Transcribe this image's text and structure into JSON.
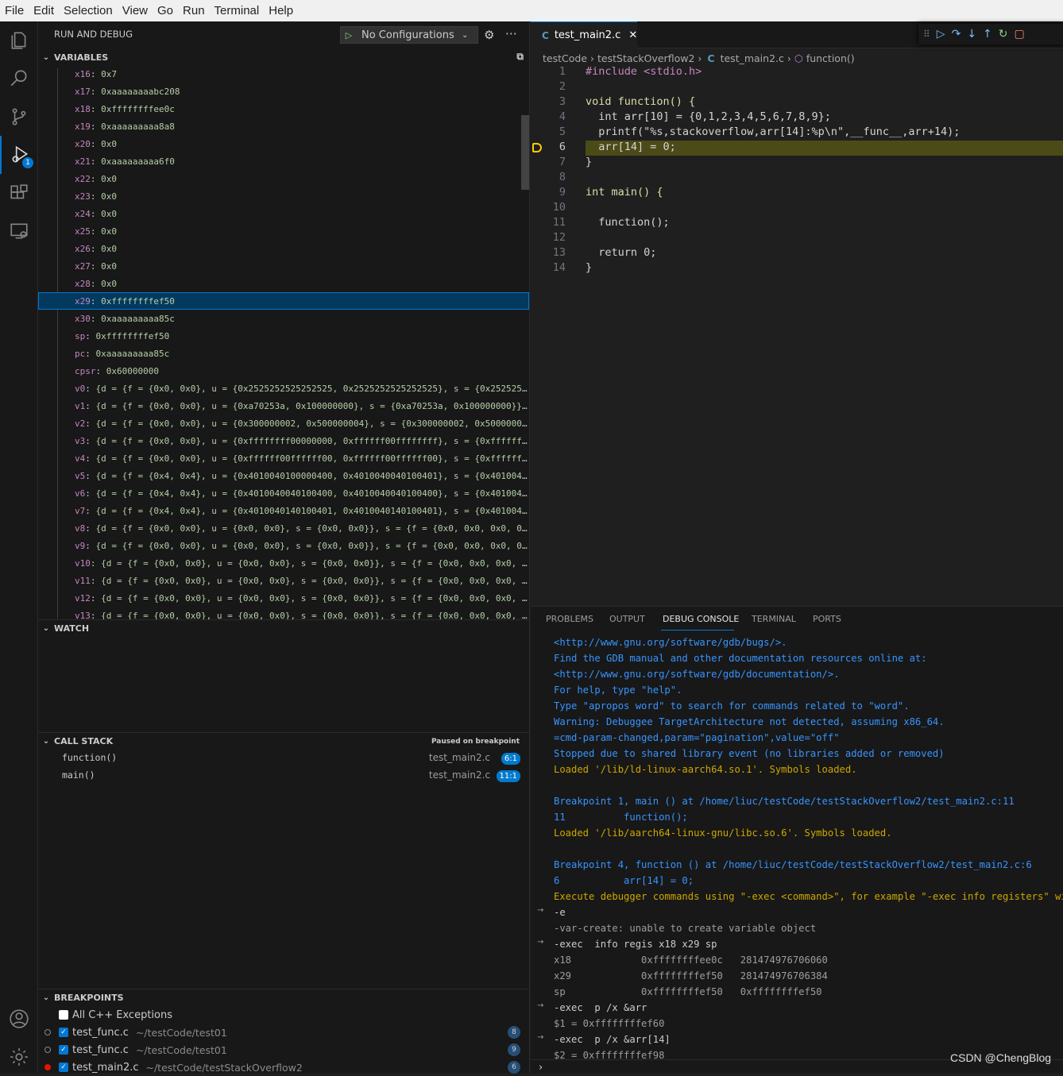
{
  "menu": [
    "File",
    "Edit",
    "Selection",
    "View",
    "Go",
    "Run",
    "Terminal",
    "Help"
  ],
  "sidebar": {
    "title": "RUN AND DEBUG",
    "config": "No Configurations",
    "variables_header": "VARIABLES",
    "variables": [
      {
        "name": "x16",
        "value": "0x7"
      },
      {
        "name": "x17",
        "value": "0xaaaaaaaabc208"
      },
      {
        "name": "x18",
        "value": "0xffffffffee0c"
      },
      {
        "name": "x19",
        "value": "0xaaaaaaaaa8a8"
      },
      {
        "name": "x20",
        "value": "0x0"
      },
      {
        "name": "x21",
        "value": "0xaaaaaaaaa6f0"
      },
      {
        "name": "x22",
        "value": "0x0"
      },
      {
        "name": "x23",
        "value": "0x0"
      },
      {
        "name": "x24",
        "value": "0x0"
      },
      {
        "name": "x25",
        "value": "0x0"
      },
      {
        "name": "x26",
        "value": "0x0"
      },
      {
        "name": "x27",
        "value": "0x0"
      },
      {
        "name": "x28",
        "value": "0x0"
      },
      {
        "name": "x29",
        "value": "0xffffffffef50"
      },
      {
        "name": "x30",
        "value": "0xaaaaaaaaa85c"
      },
      {
        "name": "sp",
        "value": "0xffffffffef50"
      },
      {
        "name": "pc",
        "value": "0xaaaaaaaaa85c"
      },
      {
        "name": "cpsr",
        "value": "0x60000000"
      },
      {
        "name": "v0",
        "value": "{d = {f = {0x0, 0x0}, u = {0x2525252525252525, 0x2525252525252525}, s = {0x25252525…"
      },
      {
        "name": "v1",
        "value": "{d = {f = {0x0, 0x0}, u = {0xa70253a, 0x100000000}, s = {0xa70253a, 0x100000000}}, …"
      },
      {
        "name": "v2",
        "value": "{d = {f = {0x0, 0x0}, u = {0x300000002, 0x500000004}, s = {0x300000002, 0x500000004…"
      },
      {
        "name": "v3",
        "value": "{d = {f = {0x0, 0x0}, u = {0xffffffff00000000, 0xffffff00ffffffff}, s = {0xffffffff…"
      },
      {
        "name": "v4",
        "value": "{d = {f = {0x0, 0x0}, u = {0xffffff00ffffff00, 0xffffff00ffffff00}, s = {0xffffff00…"
      },
      {
        "name": "v5",
        "value": "{d = {f = {0x4, 0x4}, u = {0x4010040100000400, 0x4010040040100401}, s = {0x40100401…"
      },
      {
        "name": "v6",
        "value": "{d = {f = {0x4, 0x4}, u = {0x4010040040100400, 0x4010040040100400}, s = {0x40100400…"
      },
      {
        "name": "v7",
        "value": "{d = {f = {0x4, 0x4}, u = {0x4010040140100401, 0x4010040140100401}, s = {0x40100401…"
      },
      {
        "name": "v8",
        "value": "{d = {f = {0x0, 0x0}, u = {0x0, 0x0}, s = {0x0, 0x0}}, s = {f = {0x0, 0x0, 0x0, 0x0…"
      },
      {
        "name": "v9",
        "value": "{d = {f = {0x0, 0x0}, u = {0x0, 0x0}, s = {0x0, 0x0}}, s = {f = {0x0, 0x0, 0x0, 0x0…"
      },
      {
        "name": "v10",
        "value": "{d = {f = {0x0, 0x0}, u = {0x0, 0x0}, s = {0x0, 0x0}}, s = {f = {0x0, 0x0, 0x0, 0x…"
      },
      {
        "name": "v11",
        "value": "{d = {f = {0x0, 0x0}, u = {0x0, 0x0}, s = {0x0, 0x0}}, s = {f = {0x0, 0x0, 0x0, 0x…"
      },
      {
        "name": "v12",
        "value": "{d = {f = {0x0, 0x0}, u = {0x0, 0x0}, s = {0x0, 0x0}}, s = {f = {0x0, 0x0, 0x0, 0x…"
      },
      {
        "name": "v13",
        "value": "{d = {f = {0x0, 0x0}, u = {0x0, 0x0}, s = {0x0, 0x0}}, s = {f = {0x0, 0x0, 0x0, 0x…"
      }
    ],
    "watch_header": "WATCH",
    "callstack_header": "CALL STACK",
    "callstack_status": "Paused on breakpoint",
    "callstack": [
      {
        "fn": "function()",
        "file": "test_main2.c",
        "pos": "6:1"
      },
      {
        "fn": "main()",
        "file": "test_main2.c",
        "pos": "11:1"
      }
    ],
    "breakpoints_header": "BREAKPOINTS",
    "breakpoints": [
      {
        "file": "All C++ Exceptions",
        "path": "",
        "count": ""
      },
      {
        "file": "test_func.c",
        "path": "~/testCode/test01",
        "count": "8"
      },
      {
        "file": "test_func.c",
        "path": "~/testCode/test01",
        "count": "9"
      },
      {
        "file": "test_main2.c",
        "path": "~/testCode/testStackOverflow2",
        "count": "6"
      }
    ]
  },
  "editor": {
    "tab": "test_main2.c",
    "breadcrumb": [
      "testCode",
      "testStackOverflow2",
      "test_main2.c",
      "function()"
    ],
    "lines": [
      "#include <stdio.h>",
      "",
      "void function() {",
      "  int arr[10] = {0,1,2,3,4,5,6,7,8,9};",
      "  printf(\"%s,stackoverflow,arr[14]:%p\\n\",__func__,arr+14);",
      "  arr[14] = 0;",
      "}",
      "",
      "int main() {",
      "",
      "  function();",
      "",
      "  return 0;",
      "}"
    ],
    "line_numbers": [
      "1",
      "2",
      "3",
      "4",
      "5",
      "6",
      "7",
      "8",
      "9",
      "10",
      "11",
      "12",
      "13",
      "14"
    ]
  },
  "panel": {
    "tabs": [
      "PROBLEMS",
      "OUTPUT",
      "DEBUG CONSOLE",
      "TERMINAL",
      "PORTS"
    ],
    "console": [
      {
        "t": "<http://www.gnu.org/software/gdb/bugs/>.",
        "c": "blue",
        "a": false
      },
      {
        "t": "Find the GDB manual and other documentation resources online at:",
        "c": "blue",
        "a": false
      },
      {
        "t": "<http://www.gnu.org/software/gdb/documentation/>.",
        "c": "blue",
        "a": false
      },
      {
        "t": "For help, type \"help\".",
        "c": "blue",
        "a": false
      },
      {
        "t": "Type \"apropos word\" to search for commands related to \"word\".",
        "c": "blue",
        "a": false
      },
      {
        "t": "Warning: Debuggee TargetArchitecture not detected, assuming x86_64.",
        "c": "blue",
        "a": false
      },
      {
        "t": "=cmd-param-changed,param=\"pagination\",value=\"off\"",
        "c": "blue",
        "a": false
      },
      {
        "t": "Stopped due to shared library event (no libraries added or removed)",
        "c": "blue",
        "a": false
      },
      {
        "t": "Loaded '/lib/ld-linux-aarch64.so.1'. Symbols loaded.",
        "c": "orange",
        "a": false
      },
      {
        "t": "",
        "c": "blue",
        "a": false
      },
      {
        "t": "Breakpoint 1, main () at /home/liuc/testCode/testStackOverflow2/test_main2.c:11",
        "c": "blue",
        "a": false
      },
      {
        "t": "11\t    function();",
        "c": "blue",
        "a": false
      },
      {
        "t": "Loaded '/lib/aarch64-linux-gnu/libc.so.6'. Symbols loaded.",
        "c": "orange",
        "a": false
      },
      {
        "t": "",
        "c": "blue",
        "a": false
      },
      {
        "t": "Breakpoint 4, function () at /home/liuc/testCode/testStackOverflow2/test_main2.c:6",
        "c": "blue",
        "a": false
      },
      {
        "t": "6\t    arr[14] = 0;",
        "c": "blue",
        "a": false
      },
      {
        "t": "Execute debugger commands using \"-exec <command>\", for example \"-exec info registers\" will l",
        "c": "orange",
        "a": false
      },
      {
        "t": "-e",
        "c": "gray",
        "a": true
      },
      {
        "t": "-var-create: unable to create variable object",
        "c": "dim",
        "a": false
      },
      {
        "t": "-exec  info regis x18 x29 sp",
        "c": "gray",
        "a": true
      },
      {
        "t": "x18            0xffffffffee0c   281474976706060",
        "c": "dim",
        "a": false
      },
      {
        "t": "x29            0xffffffffef50   281474976706384",
        "c": "dim",
        "a": false
      },
      {
        "t": "sp             0xffffffffef50   0xffffffffef50",
        "c": "dim",
        "a": false
      },
      {
        "t": "-exec  p /x &arr",
        "c": "gray",
        "a": true
      },
      {
        "t": "$1 = 0xffffffffef60",
        "c": "dim",
        "a": false
      },
      {
        "t": "-exec  p /x &arr[14]",
        "c": "gray",
        "a": true
      },
      {
        "t": "$2 = 0xffffffffef98",
        "c": "dim",
        "a": false
      }
    ],
    "watermark": "CSDN @ChengBlog"
  },
  "badge": "1"
}
